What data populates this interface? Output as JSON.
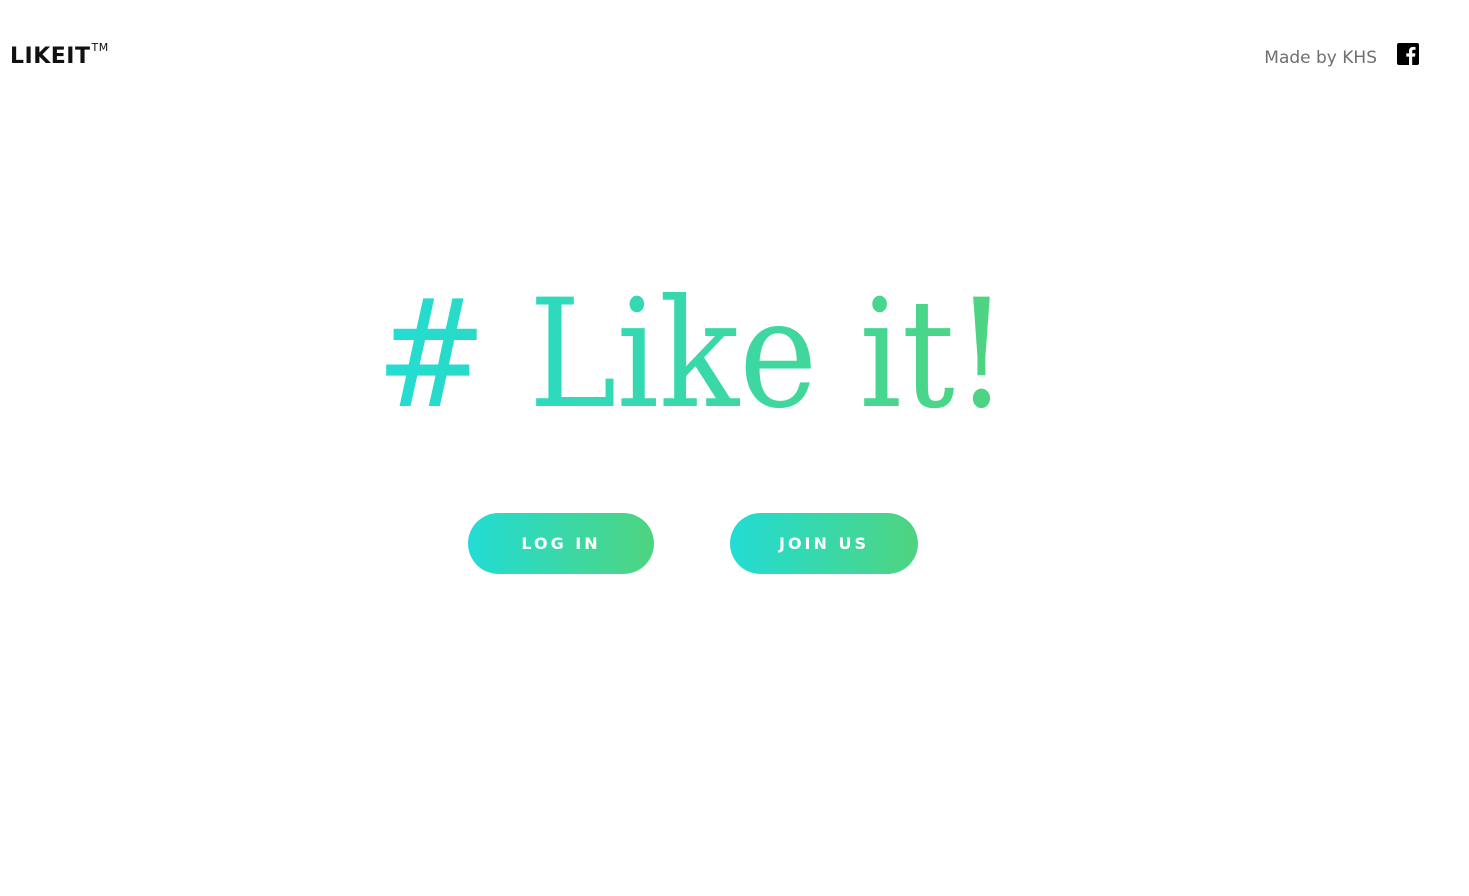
{
  "header": {
    "brand": "LIKEIT",
    "brand_tm": "TM",
    "credit": "Made by KHS",
    "social_icon": "facebook-icon"
  },
  "hero": {
    "title": "# Like it!"
  },
  "buttons": {
    "login_label": "LOG IN",
    "join_label": "JOIN US"
  },
  "colors": {
    "gradient_start": "#22dcd4",
    "gradient_end": "#4fd47f",
    "brand_text": "#111111",
    "credit_text": "#6f6f6f"
  }
}
